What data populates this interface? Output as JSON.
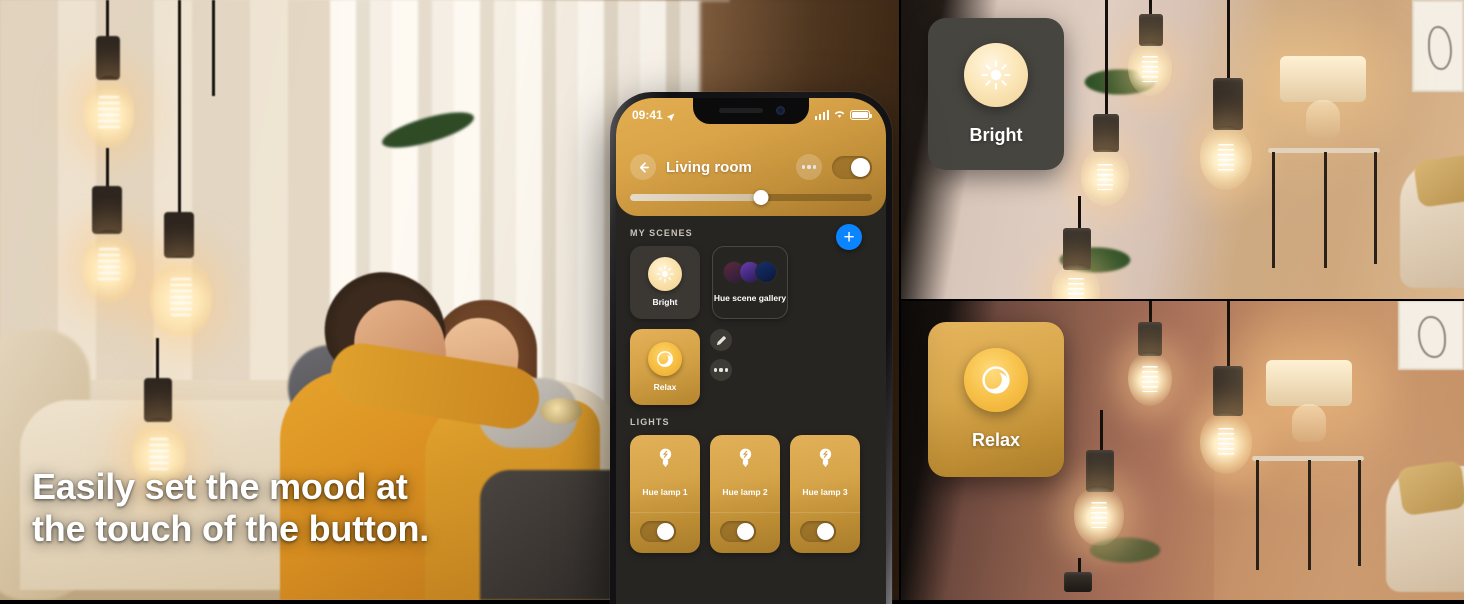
{
  "marketing": {
    "headline_line1": "Easily set the mood at",
    "headline_line2": "the touch of the button."
  },
  "phone": {
    "status_bar": {
      "time": "09:41",
      "location_icon": "location-arrow-icon",
      "signal_icon": "cellular-signal-icon",
      "wifi_icon": "wifi-icon",
      "battery_icon": "battery-full-icon"
    },
    "header": {
      "back_icon": "back-arrow-icon",
      "room_title": "Living room",
      "more_icon": "more-horizontal-icon",
      "power_toggle_state": "on",
      "brightness_percent": 54
    },
    "scenes_section": {
      "label": "MY SCENES",
      "add_button_label": "+",
      "cards": [
        {
          "name": "Bright",
          "icon": "sun-icon",
          "type": "scene"
        },
        {
          "name": "Hue scene gallery",
          "icon": "scene-thumbnails-icon",
          "type": "gallery"
        }
      ],
      "active_scene": {
        "name": "Relax",
        "icon": "moon-crescent-icon",
        "edit_icon": "pencil-icon",
        "more_icon": "more-horizontal-icon"
      }
    },
    "lights_section": {
      "label": "LIGHTS",
      "lights": [
        {
          "name": "Hue lamp 1",
          "icon": "light-bulb-icon",
          "toggle_state": "on"
        },
        {
          "name": "Hue lamp 2",
          "icon": "light-bulb-icon",
          "toggle_state": "on"
        },
        {
          "name": "Hue lamp 3",
          "icon": "light-bulb-icon",
          "toggle_state": "on"
        }
      ]
    }
  },
  "overlays": {
    "bright_card": {
      "label": "Bright",
      "icon": "sun-icon"
    },
    "relax_card": {
      "label": "Relax",
      "icon": "moon-crescent-icon"
    }
  },
  "colors": {
    "hue_amber": "#d9a348",
    "scene_card_dark": "#474540",
    "accent_blue": "#0a84ff",
    "app_background": "#272522"
  }
}
